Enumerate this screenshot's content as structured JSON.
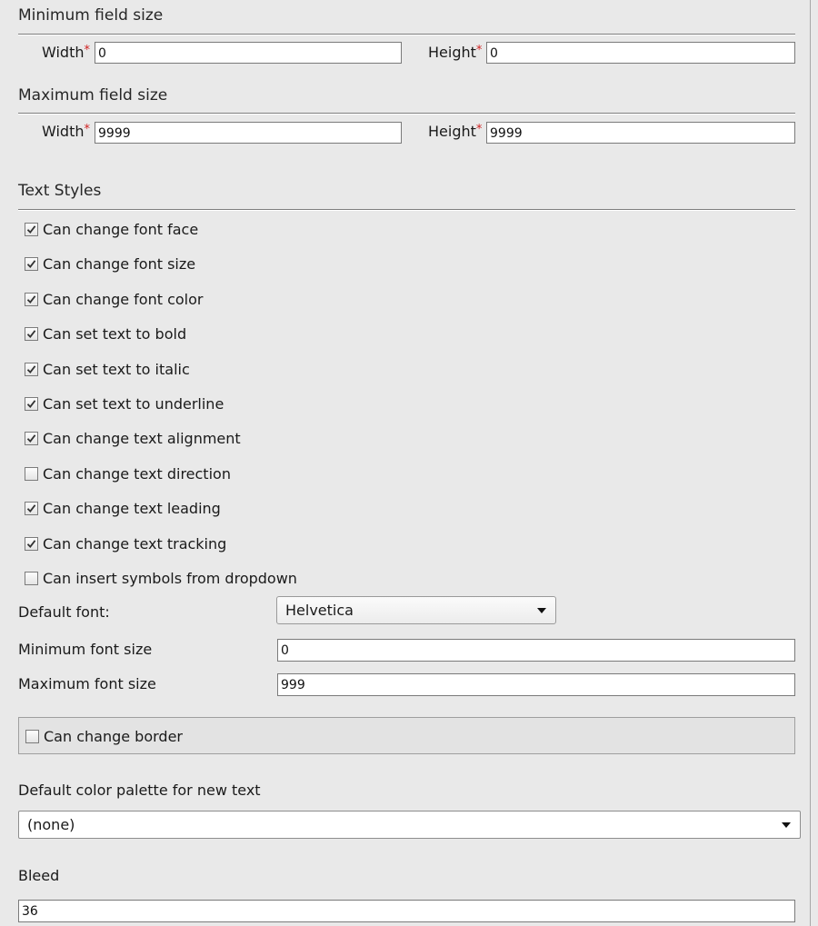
{
  "min_size": {
    "title": "Minimum field size",
    "width_label": "Width",
    "width_value": "0",
    "height_label": "Height",
    "height_value": "0",
    "required_mark": "*"
  },
  "max_size": {
    "title": "Maximum field size",
    "width_label": "Width",
    "width_value": "9999",
    "height_label": "Height",
    "height_value": "9999",
    "required_mark": "*"
  },
  "text_styles": {
    "title": "Text Styles",
    "options": [
      {
        "label": "Can change font face",
        "checked": true
      },
      {
        "label": "Can change font size",
        "checked": true
      },
      {
        "label": "Can change font color",
        "checked": true
      },
      {
        "label": "Can set text to bold",
        "checked": true
      },
      {
        "label": "Can set text to italic",
        "checked": true
      },
      {
        "label": "Can set text to underline",
        "checked": true
      },
      {
        "label": "Can change text alignment",
        "checked": true
      },
      {
        "label": "Can change text direction",
        "checked": false
      },
      {
        "label": "Can change text leading",
        "checked": true
      },
      {
        "label": "Can change text tracking",
        "checked": true
      },
      {
        "label": "Can insert symbols from dropdown",
        "checked": false
      }
    ]
  },
  "default_font": {
    "label": "Default font:",
    "value": "Helvetica"
  },
  "min_font_size": {
    "label": "Minimum font size",
    "value": "0"
  },
  "max_font_size": {
    "label": "Maximum font size",
    "value": "999"
  },
  "border": {
    "label": "Can change border",
    "checked": false
  },
  "palette": {
    "label": "Default color palette for new text",
    "value": "(none)"
  },
  "bleed": {
    "label": "Bleed",
    "value": "36"
  },
  "colors": {
    "background": "#e9e9e9",
    "required": "#d02020",
    "checkmark": "#333333"
  }
}
